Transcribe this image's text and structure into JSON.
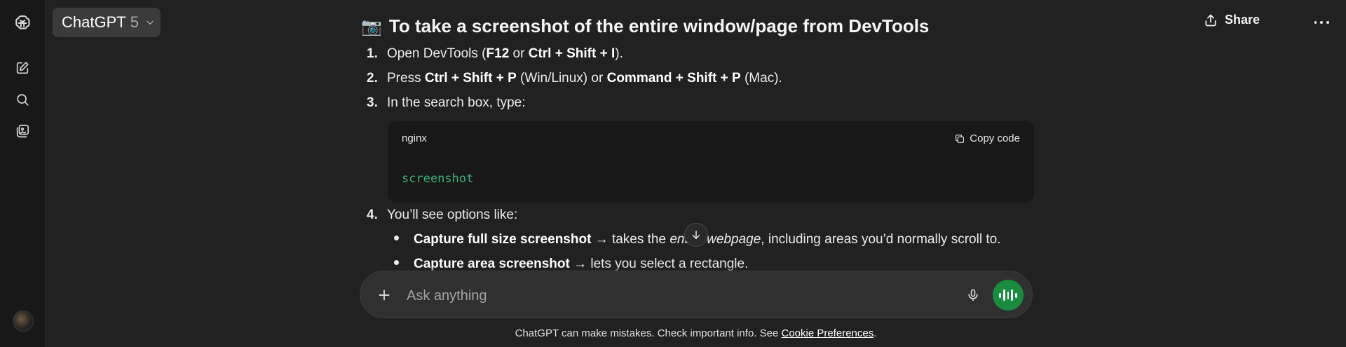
{
  "sidebar": {
    "logo_icon": "openai-logo-icon",
    "items": [
      {
        "icon": "new-chat-icon"
      },
      {
        "icon": "search-icon"
      },
      {
        "icon": "library-icon"
      }
    ],
    "avatar": "user-avatar"
  },
  "header": {
    "model_name": "ChatGPT",
    "model_version": "5",
    "share_label": "Share"
  },
  "message": {
    "heading_emoji": "📷",
    "heading": "To take a screenshot of the entire window/page from DevTools",
    "steps": [
      {
        "num": "1.",
        "p1": "Open DevTools (",
        "b1": "F12",
        "p2": " or ",
        "b2": "Ctrl + Shift + I",
        "p3": ")."
      },
      {
        "num": "2.",
        "p1": "Press ",
        "b1": "Ctrl + Shift + P",
        "p2": " (Win/Linux) or ",
        "b2": "Command + Shift + P",
        "p3": " (Mac)."
      },
      {
        "num": "3.",
        "text": "In the search box, type:"
      },
      {
        "num": "4.",
        "text": "You’ll see options like:"
      }
    ],
    "code_block": {
      "language": "nginx",
      "copy_label": "Copy code",
      "code": "screenshot"
    },
    "bullets": [
      {
        "bold": "Capture full size screenshot",
        "arrow": " → takes the ",
        "italic": "entire webpage",
        "rest": ", including areas you’d normally scroll to."
      },
      {
        "bold": "Capture area screenshot",
        "arrow": " → lets you select a rectangle."
      }
    ]
  },
  "composer": {
    "placeholder": "Ask anything"
  },
  "footer": {
    "disclaimer": "ChatGPT can make mistakes. Check important info. See ",
    "link": "Cookie Preferences",
    "end": "."
  },
  "colors": {
    "background": "#212121",
    "sidebar": "#181818",
    "code_text": "#3fb27f",
    "voice_button": "#1a8c3f"
  }
}
